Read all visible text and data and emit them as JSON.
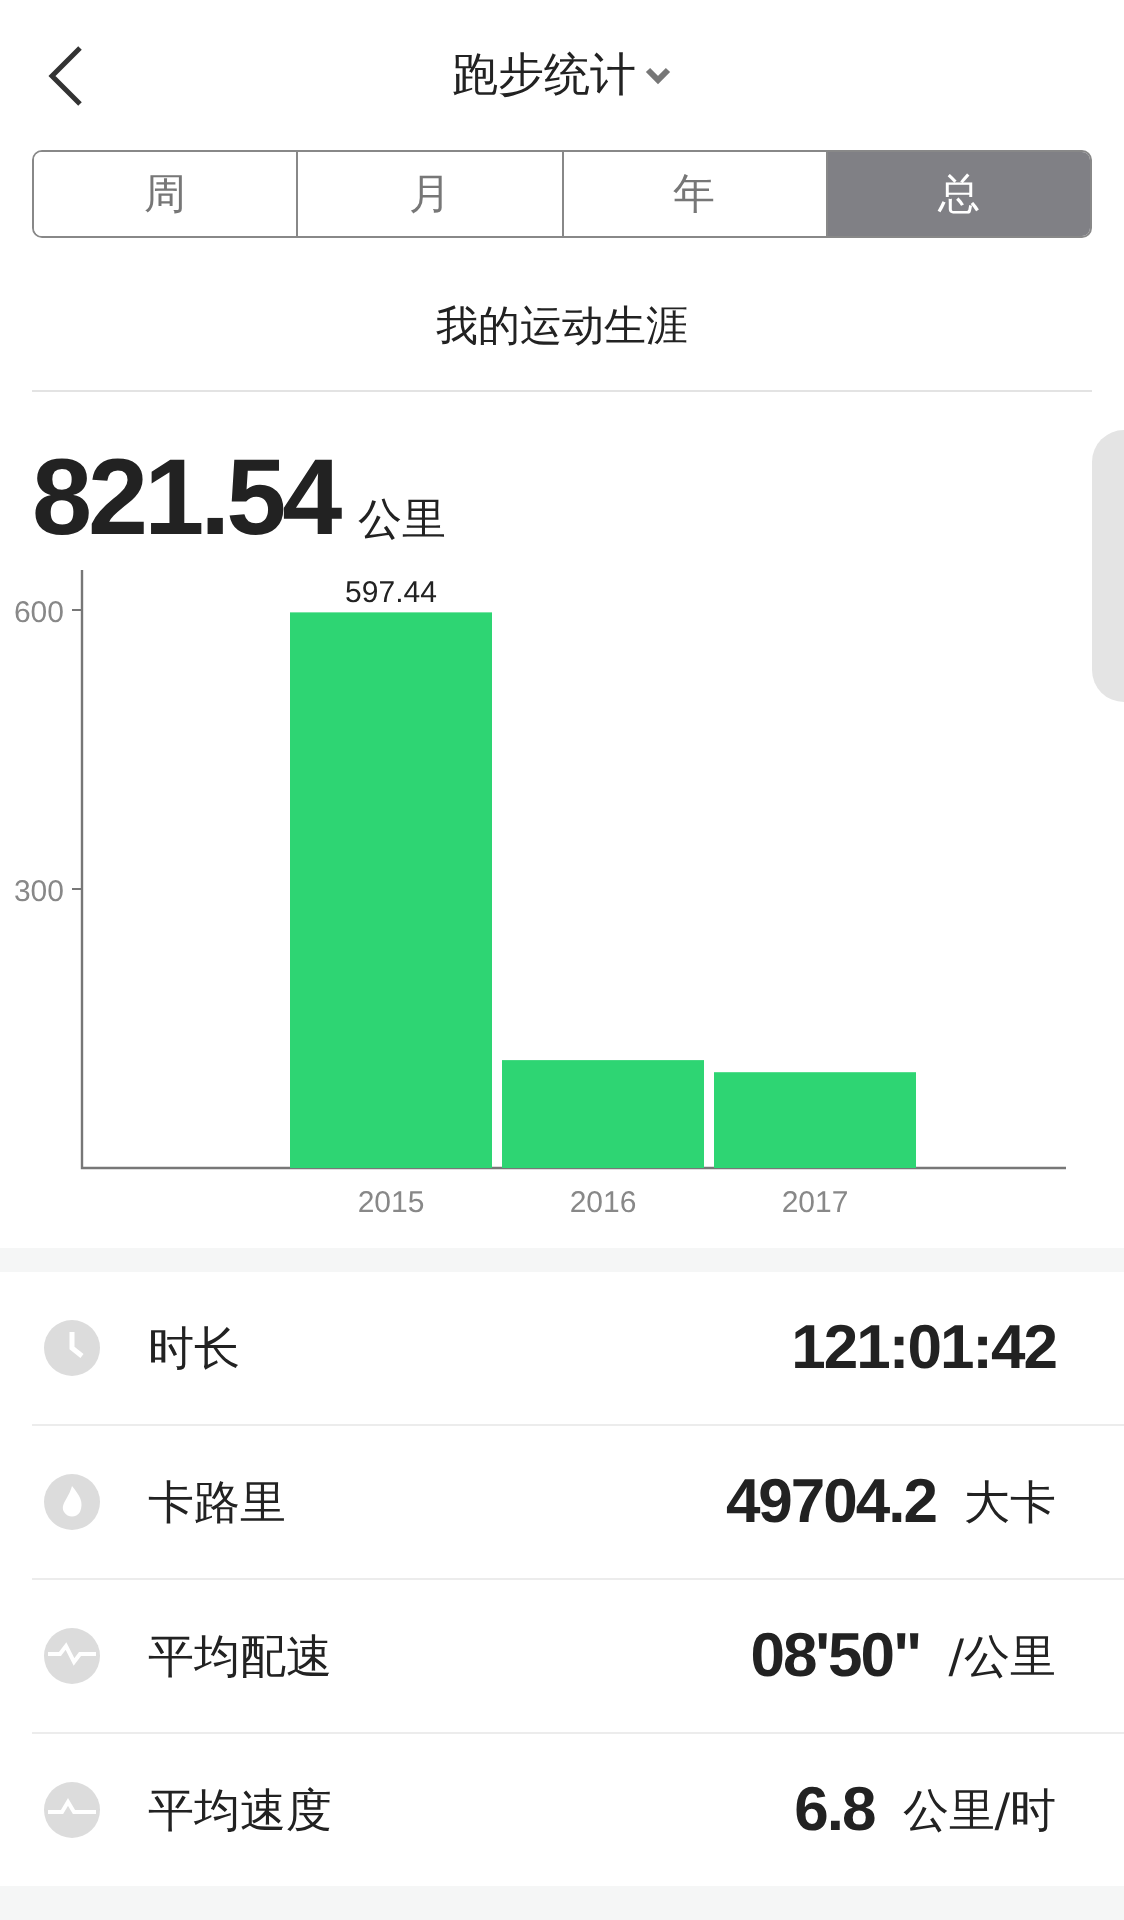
{
  "header": {
    "title": "跑步统计"
  },
  "tabs": [
    {
      "label": "周",
      "selected": false
    },
    {
      "label": "月",
      "selected": false
    },
    {
      "label": "年",
      "selected": false
    },
    {
      "label": "总",
      "selected": true
    }
  ],
  "subtitle": "我的运动生涯",
  "total": {
    "value": "821.54",
    "unit": "公里"
  },
  "chart_data": {
    "type": "bar",
    "categories": [
      "2015",
      "2016",
      "2017"
    ],
    "series": [
      {
        "color": "#2ed573",
        "values": [
          597.44,
          116,
          103
        ]
      }
    ],
    "ylim": [
      0,
      643
    ],
    "yticks": [
      300,
      600
    ],
    "value_labels": [
      "597.44",
      null,
      null
    ]
  },
  "stats": [
    {
      "kind": "clock",
      "label": "时长",
      "value": "121:01:42"
    },
    {
      "kind": "flame",
      "label": "卡路里",
      "value": "49704.2",
      "unit": "大卡"
    },
    {
      "kind": "pace",
      "label": "平均配速",
      "value": "08'50\"",
      "unit": "/公里"
    },
    {
      "kind": "speed",
      "label": "平均速度",
      "value": "6.8",
      "unit": "公里/时"
    }
  ]
}
